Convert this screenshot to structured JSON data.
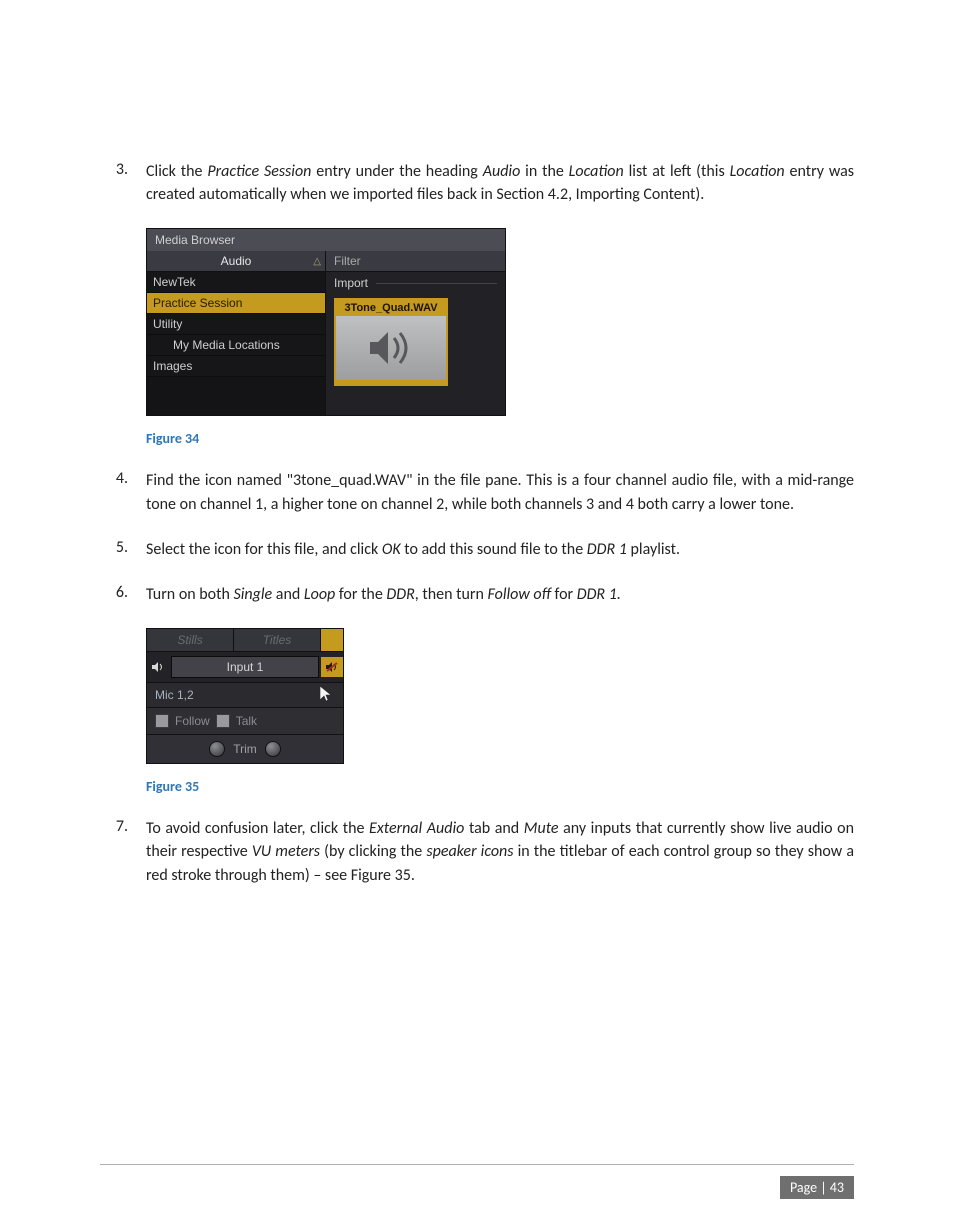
{
  "items": {
    "n3": {
      "num": "3.",
      "text_a": "Click the ",
      "i1": "Practice Session",
      "text_b": " entry under the heading ",
      "i2": "Audio",
      "text_c": " in the ",
      "i3": "Location",
      "text_d": " list at left (this ",
      "i4": "Location",
      "text_e": " entry was created automatically when we imported files back in Section 4.2, Importing Content)."
    },
    "n4": {
      "num": "4.",
      "text": "Find the icon named \"3tone_quad.WAV\" in the file pane.  This is a four channel audio file, with a mid-range tone on channel 1, a higher tone on channel 2, while both channels 3 and 4 both carry a lower tone."
    },
    "n5": {
      "num": "5.",
      "text_a": "Select the icon for this file, and click ",
      "i1": "OK",
      "text_b": " to add this sound file to the ",
      "i2": "DDR 1",
      "text_c": " playlist."
    },
    "n6": {
      "num": "6.",
      "text_a": "Turn on both ",
      "i1": "Single",
      "text_b": " and ",
      "i2": "Loop",
      "text_c": " for the ",
      "i3": "DDR",
      "text_d": ", then turn ",
      "i4": "Follow off",
      "text_e": " for ",
      "i5": "DDR 1."
    },
    "n7": {
      "num": "7.",
      "text_a": "To avoid confusion later, click the ",
      "i1": "External Audio",
      "text_b": " tab and ",
      "i2": "Mute",
      "text_c": " any inputs that currently show live audio on their respective ",
      "i3": "VU meters",
      "text_d": " (by clicking the ",
      "i4": "speaker icons",
      "text_e": " in the titlebar of each control group so they show a red stroke through them) – see Figure 35."
    }
  },
  "fig34": {
    "caption": "Figure 34",
    "title": "Media Browser",
    "audio_header": "Audio",
    "list": {
      "newtek": "NewTek",
      "practice": "Practice Session",
      "utility": "Utility",
      "my_media": "My Media Locations",
      "images": "Images"
    },
    "filter": "Filter",
    "import": "Import",
    "file": "3Tone_Quad.WAV",
    "triangle": "△"
  },
  "fig35": {
    "caption": "Figure 35",
    "tabs": {
      "stills": "Stills",
      "titles": "Titles"
    },
    "input": "Input 1",
    "mic": "Mic 1,2",
    "follow": "Follow",
    "talk": "Talk",
    "trim": "Trim"
  },
  "footer": {
    "page": "Page | 43"
  }
}
